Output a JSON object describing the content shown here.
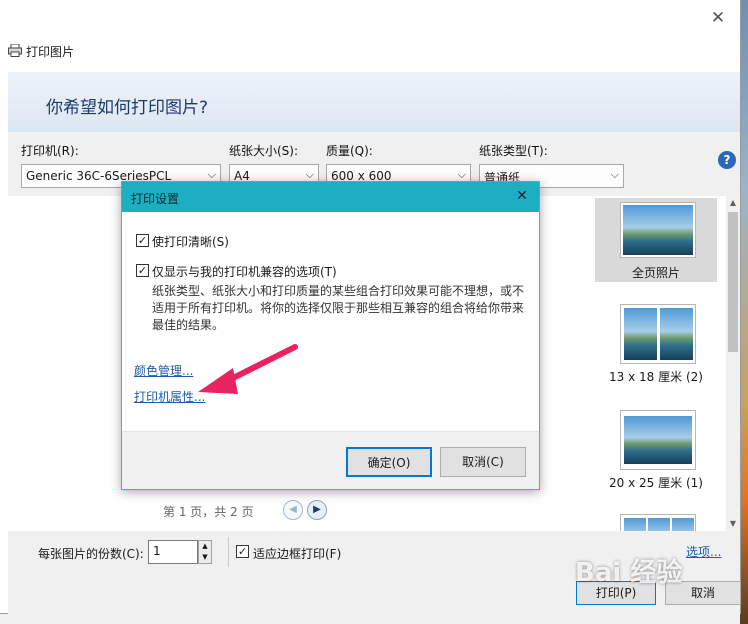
{
  "window": {
    "title": "打印图片"
  },
  "banner": {
    "question": "你希望如何打印图片?"
  },
  "options": {
    "printer": {
      "label": "打印机(R):",
      "value": "Generic 36C-6SeriesPCL"
    },
    "paper_size": {
      "label": "纸张大小(S):",
      "value": "A4"
    },
    "quality": {
      "label": "质量(Q):",
      "value": "600 x 600"
    },
    "paper_type": {
      "label": "纸张类型(T):",
      "value": "普通纸"
    }
  },
  "preview": {
    "page_info": "第 1 页，共 2 页"
  },
  "layouts": [
    {
      "label": "全页照片",
      "selected": true
    },
    {
      "label": "13 x 18 厘米 (2)",
      "selected": false
    },
    {
      "label": "20 x 25 厘米 (1)",
      "selected": false
    }
  ],
  "bottom": {
    "copies_label": "每张图片的份数(C):",
    "copies_value": "1",
    "fit_label": "适应边框打印(F)",
    "fit_checked": true,
    "options_link": "选项...",
    "print_button": "打印(P)",
    "cancel_button": "取消"
  },
  "modal": {
    "title": "打印设置",
    "clear_label": "使打印清晰(S)",
    "clear_checked": true,
    "compat_label": "仅显示与我的打印机兼容的选项(T)",
    "compat_checked": true,
    "compat_desc": "纸张类型、纸张大小和打印质量的某些组合打印效果可能不理想，或不适用于所有打印机。将你的选择仅限于那些相互兼容的组合将给你带来最佳的结果。",
    "color_link": "颜色管理...",
    "printer_props_link": "打印机属性...",
    "ok_button": "确定(O)",
    "cancel_button": "取消(C)"
  },
  "watermark": "Bai 经验",
  "colors": {
    "accent": "#1eaec2",
    "link": "#1f5aa6",
    "arrow": "#e8235f"
  }
}
